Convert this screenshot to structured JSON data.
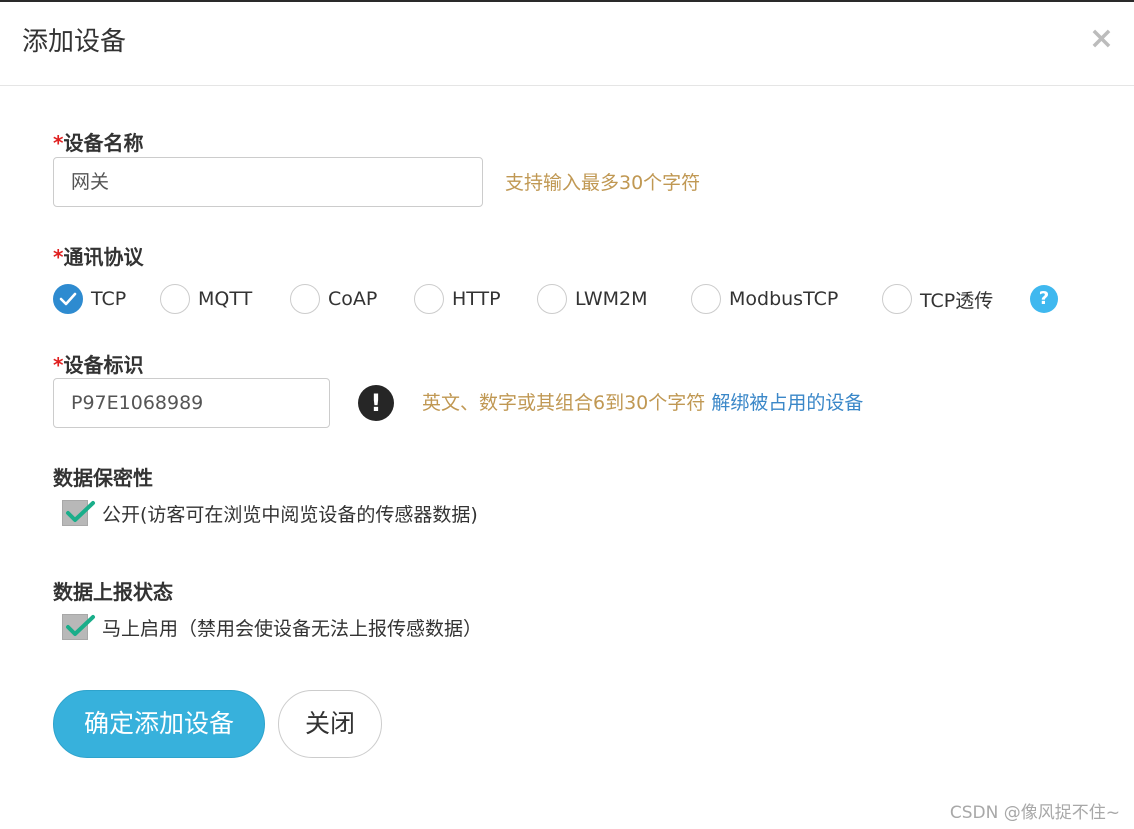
{
  "dialog": {
    "title": "添加设备",
    "close_symbol": "×"
  },
  "device_name": {
    "required_mark": "*",
    "label": "设备名称",
    "value": "网关",
    "hint": "支持输入最多30个字符"
  },
  "protocol": {
    "required_mark": "*",
    "label": "通讯协议",
    "options": [
      {
        "label": "TCP",
        "checked": true
      },
      {
        "label": "MQTT",
        "checked": false
      },
      {
        "label": "CoAP",
        "checked": false
      },
      {
        "label": "HTTP",
        "checked": false
      },
      {
        "label": "LWM2M",
        "checked": false
      },
      {
        "label": "ModbusTCP",
        "checked": false
      },
      {
        "label": "TCP透传",
        "checked": false
      }
    ],
    "help_symbol": "?"
  },
  "device_id": {
    "required_mark": "*",
    "label": "设备标识",
    "value": "P97E1068989",
    "warn_symbol": "!",
    "hint": "英文、数字或其组合6到30个字符",
    "unbind_link": "解绑被占用的设备"
  },
  "privacy": {
    "label": "数据保密性",
    "checkbox_label": "公开(访客可在浏览中阅览设备的传感器数据)",
    "checked": true
  },
  "report": {
    "label": "数据上报状态",
    "checkbox_label": "马上启用（禁用会使设备无法上报传感数据）",
    "checked": true
  },
  "buttons": {
    "confirm": "确定添加设备",
    "close": "关闭"
  },
  "watermark": "CSDN @像风捉不住~",
  "colors": {
    "primary_button": "#37b1dc",
    "radio_checked": "#2e8bd0",
    "hint_text": "#c09853",
    "link": "#3a87c8",
    "required": "#e02020",
    "help_icon": "#3fb8ef",
    "check_mark": "#1aae8a"
  },
  "icons": [
    "close-icon",
    "help-icon",
    "warning-icon",
    "check-icon"
  ]
}
